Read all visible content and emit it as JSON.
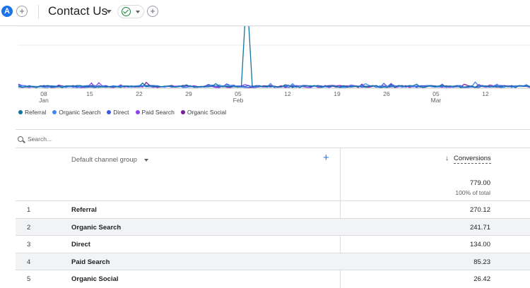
{
  "topbar": {
    "avatar_letter": "A",
    "add_symbol": "+",
    "report_title": "Contact Us",
    "status_add_symbol": "+"
  },
  "chart_data": {
    "type": "line",
    "x_ticks": [
      {
        "day": "08",
        "month": "Jan"
      },
      {
        "day": "15",
        "month": ""
      },
      {
        "day": "22",
        "month": ""
      },
      {
        "day": "29",
        "month": ""
      },
      {
        "day": "05",
        "month": "Feb"
      },
      {
        "day": "12",
        "month": ""
      },
      {
        "day": "19",
        "month": ""
      },
      {
        "day": "26",
        "month": ""
      },
      {
        "day": "05",
        "month": "Mar"
      },
      {
        "day": "12",
        "month": ""
      }
    ],
    "legend": [
      {
        "name": "Referral",
        "color": "#12739e"
      },
      {
        "name": "Organic Search",
        "color": "#4285f4"
      },
      {
        "name": "Direct",
        "color": "#3b5bdb"
      },
      {
        "name": "Paid Search",
        "color": "#8e44e8"
      },
      {
        "name": "Organic Social",
        "color": "#7b1fa2"
      }
    ],
    "grid": true
  },
  "search": {
    "placeholder": "Search..."
  },
  "table": {
    "dimension_label": "Default channel group",
    "add_dimension": "+",
    "sort_arrow": "↓",
    "metric_label": "Conversions",
    "total_value": "779.00",
    "total_pct": "100% of total",
    "rows": [
      {
        "idx": "1",
        "name": "Referral",
        "value": "270.12"
      },
      {
        "idx": "2",
        "name": "Organic Search",
        "value": "241.71"
      },
      {
        "idx": "3",
        "name": "Direct",
        "value": "134.00"
      },
      {
        "idx": "4",
        "name": "Paid Search",
        "value": "85.23"
      },
      {
        "idx": "5",
        "name": "Organic Social",
        "value": "26.42"
      }
    ]
  }
}
